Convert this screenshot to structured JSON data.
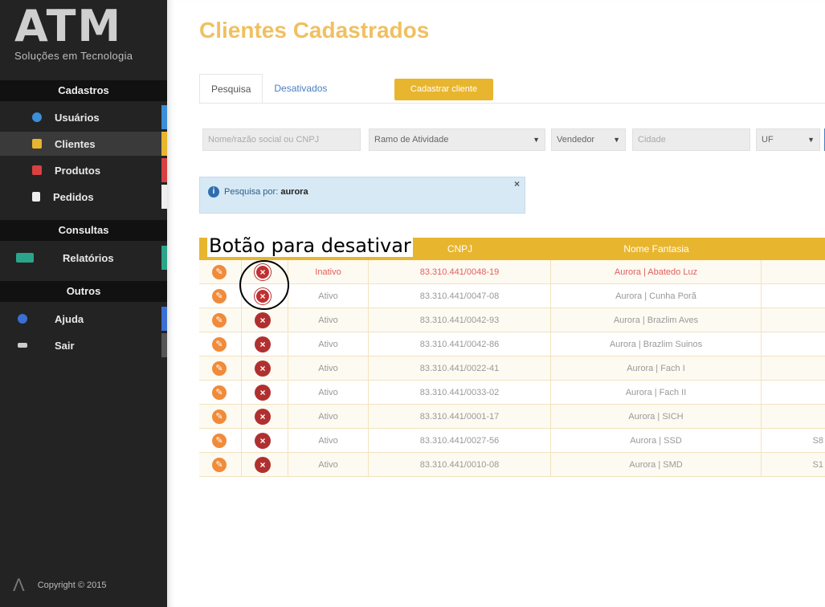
{
  "sidebar": {
    "logo": {
      "mark": "ATM",
      "subtitle": "Soluções em Tecnologia"
    },
    "sections": [
      {
        "header": "Cadastros",
        "items": [
          {
            "label": "Usuários",
            "icon": "user-icon",
            "icon_color": "#3a8fd6",
            "accent": "#3a8fd6"
          },
          {
            "label": "Clientes",
            "icon": "envelope-icon",
            "icon_color": "#e8b52e",
            "accent": "#e8b52e",
            "active": true
          },
          {
            "label": "Produtos",
            "icon": "box-icon",
            "icon_color": "#d94040",
            "accent": "#d94040"
          },
          {
            "label": "Pedidos",
            "icon": "document-icon",
            "icon_color": "#eeeeee",
            "accent": "#eeeeee"
          }
        ]
      },
      {
        "header": "Consultas",
        "items": [
          {
            "label": "Relatórios",
            "icon": "chart-icon",
            "icon_color": "#2aa58a",
            "accent": "#2aa58a"
          }
        ]
      },
      {
        "header": "Outros",
        "items": [
          {
            "label": "Ajuda",
            "icon": "help-icon",
            "icon_color": "#3a6fd6",
            "accent": "#3a6fd6"
          },
          {
            "label": "Sair",
            "icon": "exit-icon",
            "icon_color": "#cccccc",
            "accent": "#555555"
          }
        ]
      }
    ],
    "copyright": "Copyright © 2015"
  },
  "main": {
    "title": "Clientes Cadastrados",
    "tabs": [
      {
        "label": "Pesquisa",
        "active": true
      },
      {
        "label": "Desativados",
        "active": false
      }
    ],
    "add_button": "Cadastrar cliente",
    "filters": {
      "name_placeholder": "Nome/razão social ou CNPJ",
      "ramo": "Ramo de Atividade",
      "vendedor": "Vendedor",
      "cidade_placeholder": "Cidade",
      "uf": "UF"
    },
    "alert": {
      "prefix": "Pesquisa por:",
      "term": "aurora",
      "close": "×"
    },
    "table": {
      "headers": [
        "",
        "",
        "",
        "CNPJ",
        "Nome Fantasia",
        ""
      ],
      "rows": [
        {
          "status": "Inativo",
          "cnpj": "83.310.441/0048-19",
          "name": "Aurora | Abatedo Luz",
          "extra": "",
          "red": true
        },
        {
          "status": "Ativo",
          "cnpj": "83.310.441/0047-08",
          "name": "Aurora | Cunha Porã",
          "extra": "",
          "red": false
        },
        {
          "status": "Ativo",
          "cnpj": "83.310.441/0042-93",
          "name": "Aurora | Brazlim Aves",
          "extra": "",
          "red": false
        },
        {
          "status": "Ativo",
          "cnpj": "83.310.441/0042-86",
          "name": "Aurora | Brazlim Suinos",
          "extra": "",
          "red": false
        },
        {
          "status": "Ativo",
          "cnpj": "83.310.441/0022-41",
          "name": "Aurora | Fach I",
          "extra": "",
          "red": false
        },
        {
          "status": "Ativo",
          "cnpj": "83.310.441/0033-02",
          "name": "Aurora | Fach II",
          "extra": "",
          "red": false
        },
        {
          "status": "Ativo",
          "cnpj": "83.310.441/0001-17",
          "name": "Aurora | SICH",
          "extra": "",
          "red": false
        },
        {
          "status": "Ativo",
          "cnpj": "83.310.441/0027-56",
          "name": "Aurora | SSD",
          "extra": "S8",
          "red": false
        },
        {
          "status": "Ativo",
          "cnpj": "83.310.441/0010-08",
          "name": "Aurora | SMD",
          "extra": "S1",
          "red": false
        }
      ]
    }
  },
  "annotation": {
    "label": "Botão para desativar"
  },
  "colors": {
    "accent": "#e8b52e",
    "title": "#f0c060",
    "sidebar": "#232323",
    "delete": "#b03030",
    "edit": "#f08b3a"
  }
}
